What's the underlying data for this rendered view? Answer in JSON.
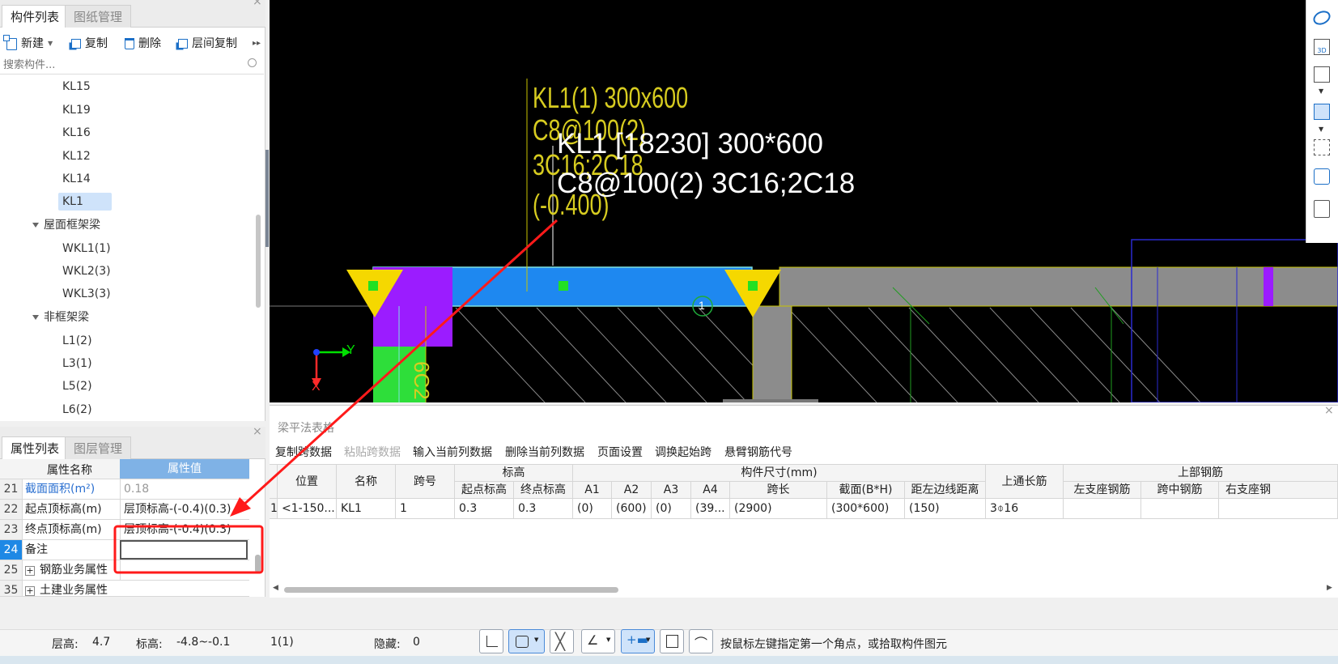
{
  "left_top": {
    "tabs": [
      "构件列表",
      "图纸管理"
    ],
    "toolbar": {
      "new": "新建",
      "copy": "复制",
      "delete": "删除",
      "floor_copy": "层间复制"
    },
    "search_placeholder": "搜索构件...",
    "tree": {
      "items_a": [
        "KL15",
        "KL19",
        "KL16",
        "KL12",
        "KL14",
        "KL1"
      ],
      "group_roof": "屋面框架梁",
      "items_b": [
        "WKL1(1)",
        "WKL2(3)",
        "WKL3(3)"
      ],
      "group_nonframe": "非框架梁",
      "items_c": [
        "L1(2)",
        "L3(1)",
        "L5(2)",
        "L6(2)"
      ]
    }
  },
  "left_bottom": {
    "tabs": [
      "属性列表",
      "图层管理"
    ],
    "col_name": "属性名称",
    "col_value": "属性值",
    "rows": [
      {
        "num": "21",
        "name": "截面面积(m²)",
        "value": "0.18"
      },
      {
        "num": "22",
        "name": "起点顶标高(m)",
        "value": "层顶标高-(-0.4)(0.3)"
      },
      {
        "num": "23",
        "name": "终点顶标高(m)",
        "value": "层顶标高-(-0.4)(0.3)"
      },
      {
        "num": "24",
        "name": "备注",
        "value": ""
      },
      {
        "num": "25",
        "name": "钢筋业务属性",
        "value": ""
      },
      {
        "num": "35",
        "name": "土建业务属性",
        "value": ""
      }
    ]
  },
  "cad": {
    "annot_yellow": [
      "KL1(1) 300x600",
      "C8@100(2)",
      "3C16;2C18",
      "(-0.400)"
    ],
    "annot_white_1": "KL1 [18230] 300*600",
    "annot_white_2": "C8@100(2) 3C16;2C18",
    "axis_y": "Y",
    "axis_x": "X",
    "span_marker": "1",
    "side_text": "6C2"
  },
  "beam_table": {
    "title": "梁平法表格",
    "toolbar": [
      "复制跨数据",
      "粘贴跨数据",
      "输入当前列数据",
      "删除当前列数据",
      "页面设置",
      "调换起始跨",
      "悬臂钢筋代号"
    ],
    "headers": {
      "pos": "位置",
      "name": "名称",
      "span": "跨号",
      "elev": "标高",
      "elev_start": "起点标高",
      "elev_end": "终点标高",
      "size": "构件尺寸(mm)",
      "a1": "A1",
      "a2": "A2",
      "a3": "A3",
      "a4": "A4",
      "span_len": "跨长",
      "section": "截面(B*H)",
      "dist": "距左边线距离",
      "top_through": "上通长筋",
      "top_rebar": "上部钢筋",
      "left_support": "左支座钢筋",
      "mid": "跨中钢筋",
      "right_support": "右支座钢"
    },
    "row": {
      "idx": "1",
      "pos": "<1-150...",
      "name": "KL1",
      "span": "1",
      "elev_start": "0.3",
      "elev_end": "0.3",
      "a1": "(0)",
      "a2": "(600)",
      "a3": "(0)",
      "a4": "(39...",
      "span_len": "(2900)",
      "section": "(300*600)",
      "dist": "(150)",
      "top_through": "3⌽16"
    }
  },
  "status": {
    "floor_height_label": "层高:",
    "floor_height": "4.7",
    "elev_label": "标高:",
    "elev": "-4.8~-0.1",
    "count": "1(1)",
    "hidden_label": "隐藏:",
    "hidden": "0",
    "hint": "按鼠标左键指定第一个角点，或拾取构件图元"
  }
}
